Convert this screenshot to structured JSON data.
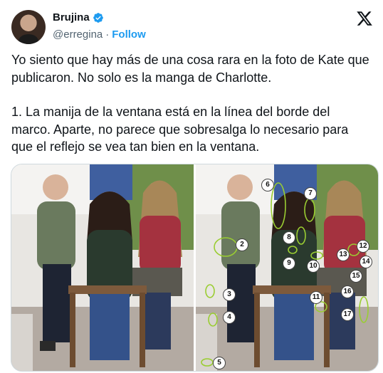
{
  "author": {
    "name": "Brujina",
    "handle": "@erregina",
    "separator": "·",
    "follow_label": "Follow"
  },
  "tweet": {
    "paragraph1": "Yo siento que hay más de una cosa rara en la foto de Kate que publicaron. No solo es la manga de Charlotte.",
    "paragraph2": "1. La manija de la ventana está en la línea del borde del marco. Aparte, no parece que sobresalga lo necesario para que el reflejo se vea tan bien en la ventana."
  },
  "annotations": [
    "2",
    "3",
    "4",
    "5",
    "6",
    "7",
    "8",
    "9",
    "10",
    "11",
    "12",
    "13",
    "14",
    "15",
    "16",
    "17"
  ],
  "colors": {
    "follow": "#1d9bf0",
    "verified": "#1d9bf0",
    "annotation_circle": "#9acd32"
  },
  "icons": {
    "verified": "verified-badge-icon",
    "logo": "x-logo-icon"
  }
}
